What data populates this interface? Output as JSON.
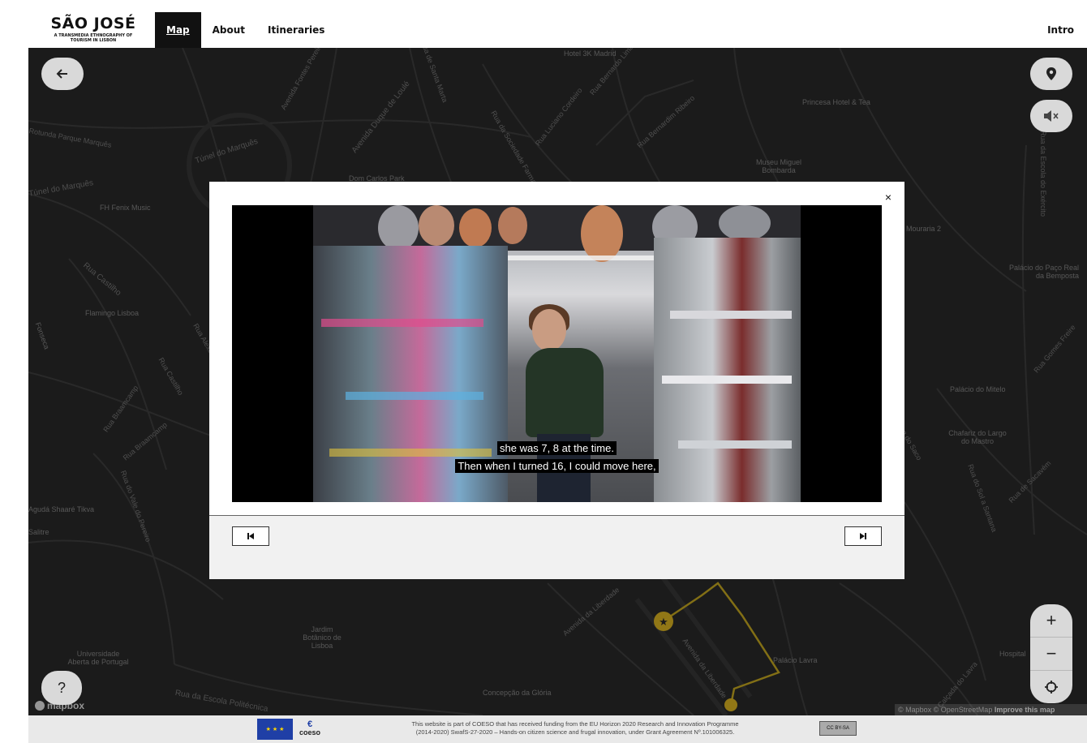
{
  "nav": {
    "brand_title": "SÃO JOSÉ",
    "brand_subtitle": "A TRANSMEDIA ETHNOGRAPHY OF TOURISM IN LISBON",
    "items": [
      {
        "label": "Map",
        "active": true
      },
      {
        "label": "About",
        "active": false
      },
      {
        "label": "Itineraries",
        "active": false
      }
    ],
    "intro_label": "Intro"
  },
  "map": {
    "labels": [
      {
        "text": "Hotel 3K Madrid"
      },
      {
        "text": "Princesa Hotel & Tea"
      },
      {
        "text": "Museu Miguel Bombarda"
      },
      {
        "text": "Dom Carlos Park"
      },
      {
        "text": "FH Fenix Music"
      },
      {
        "text": "Flamingo Lisboa"
      },
      {
        "text": "Mouraria 2"
      },
      {
        "text": "Palácio do Paço Real da Bemposta"
      },
      {
        "text": "Palácio do Mitelo"
      },
      {
        "text": "Chafariz do Largo do Mastro"
      },
      {
        "text": "Jardim Botânico de Lisboa"
      },
      {
        "text": "Universidade Aberta de Portugal"
      },
      {
        "text": "Palácio Lavra"
      },
      {
        "text": "Hospital"
      },
      {
        "text": "Túnel do Marquês"
      },
      {
        "text": "Rua Castilho"
      },
      {
        "text": "Avenida Duque de Loulé"
      },
      {
        "text": "Rua da Escola Politécnica"
      },
      {
        "text": "Avenida da Liberdade"
      },
      {
        "text": "Rua Luciano Cordeiro"
      },
      {
        "text": "Rua Bernardim Ribeiro"
      },
      {
        "text": "Rua de Santa Marta"
      },
      {
        "text": "Rua Braamcamp"
      },
      {
        "text": "Rua do Sol a Santana"
      },
      {
        "text": "Rua da Escola do Exército"
      },
      {
        "text": "Rua Gomes Freire"
      },
      {
        "text": "Calçada do Lavra"
      },
      {
        "text": "Rua de Sacavém"
      },
      {
        "text": "Rua do Saco"
      },
      {
        "text": "Rua Castilho"
      },
      {
        "text": "Rua da Sociedade Farmacêutica"
      },
      {
        "text": "Avenida Fontes Pereira"
      },
      {
        "text": "Rotunda Parque Marquês"
      },
      {
        "text": "Túnel do Marquês"
      },
      {
        "text": "Agudá Shaaré Tikva"
      },
      {
        "text": "Salitre"
      },
      {
        "text": "Concepção da Glória"
      },
      {
        "text": "Rua Bernardo Lima"
      },
      {
        "text": "Rua Braamcamp"
      },
      {
        "text": "Rua Alexandre Herculano"
      },
      {
        "text": "Fonseca"
      },
      {
        "text": "Rua do Vale do Pereiro"
      },
      {
        "text": "Avenida da Liberdade"
      }
    ],
    "attribution": "© Mapbox © OpenStreetMap",
    "attribution_link": "Improve this map",
    "mapbox_logo": "mapbox",
    "controls": {
      "back_icon": "arrow-left-icon",
      "location_icon": "map-pin-icon",
      "mute_icon": "speaker-mute-icon",
      "help_label": "?",
      "zoom_in": "+",
      "zoom_out": "−",
      "locate_icon": "crosshair-icon"
    }
  },
  "modal": {
    "close_label": "×",
    "captions": [
      "she was 7, 8 at the time.",
      "Then when I turned 16, I could move here,"
    ],
    "prev_icon": "skip-back-icon",
    "next_icon": "skip-forward-icon"
  },
  "footer": {
    "coeso_label": "coeso",
    "funding_text_line1": "This website is part of COESO that has received funding from the EU Horizon 2020 Research and Innovation Programme",
    "funding_text_line2": "(2014-2020) SwafS-27-2020 – Hands-on citizen science and frugal innovation, under Grant Agreement Nº.101006325.",
    "license_label": "CC BY-SA"
  }
}
